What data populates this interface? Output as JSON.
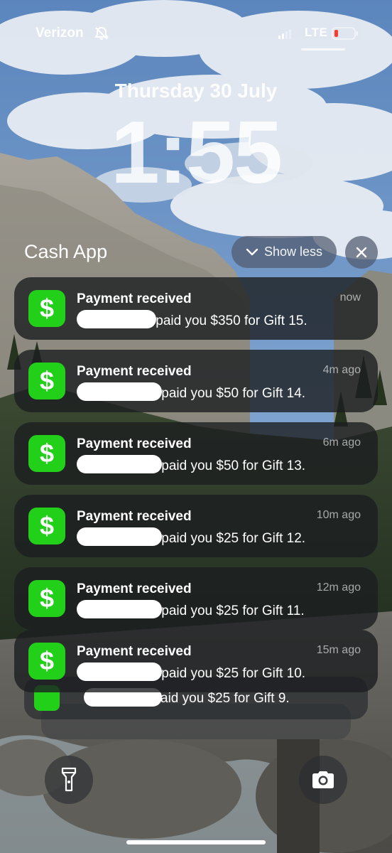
{
  "status_bar": {
    "carrier": "Verizon",
    "network": "LTE",
    "icons": [
      "bell-slash-icon",
      "signal-icon",
      "battery-low-icon"
    ],
    "battery_color": "#ff3b30"
  },
  "lock_screen": {
    "date": "Thursday 30 July",
    "time": "1:55"
  },
  "notification_group": {
    "app_name": "Cash App",
    "show_less_label": "Show less",
    "accent_color": "#22d01a",
    "app_icon_glyph": "$",
    "notifications": [
      {
        "title": "Payment received",
        "body": "paid you $350 for Gift 15.",
        "time": "now"
      },
      {
        "title": "Payment received",
        "body": "paid you $50 for Gift 14.",
        "time": "4m ago"
      },
      {
        "title": "Payment received",
        "body": "paid you $50 for Gift 13.",
        "time": "6m ago"
      },
      {
        "title": "Payment received",
        "body": "paid you $25 for Gift 12.",
        "time": "10m ago"
      },
      {
        "title": "Payment received",
        "body": "paid you $25 for Gift 11.",
        "time": "12m ago"
      },
      {
        "title": "Payment received",
        "body": "paid you $25 for Gift 10.",
        "time": "15m ago"
      },
      {
        "title": "",
        "body": "aid you $25 for Gift 9.",
        "time": ""
      }
    ]
  },
  "bottom_controls": {
    "left": "flashlight-icon",
    "right": "camera-icon"
  }
}
